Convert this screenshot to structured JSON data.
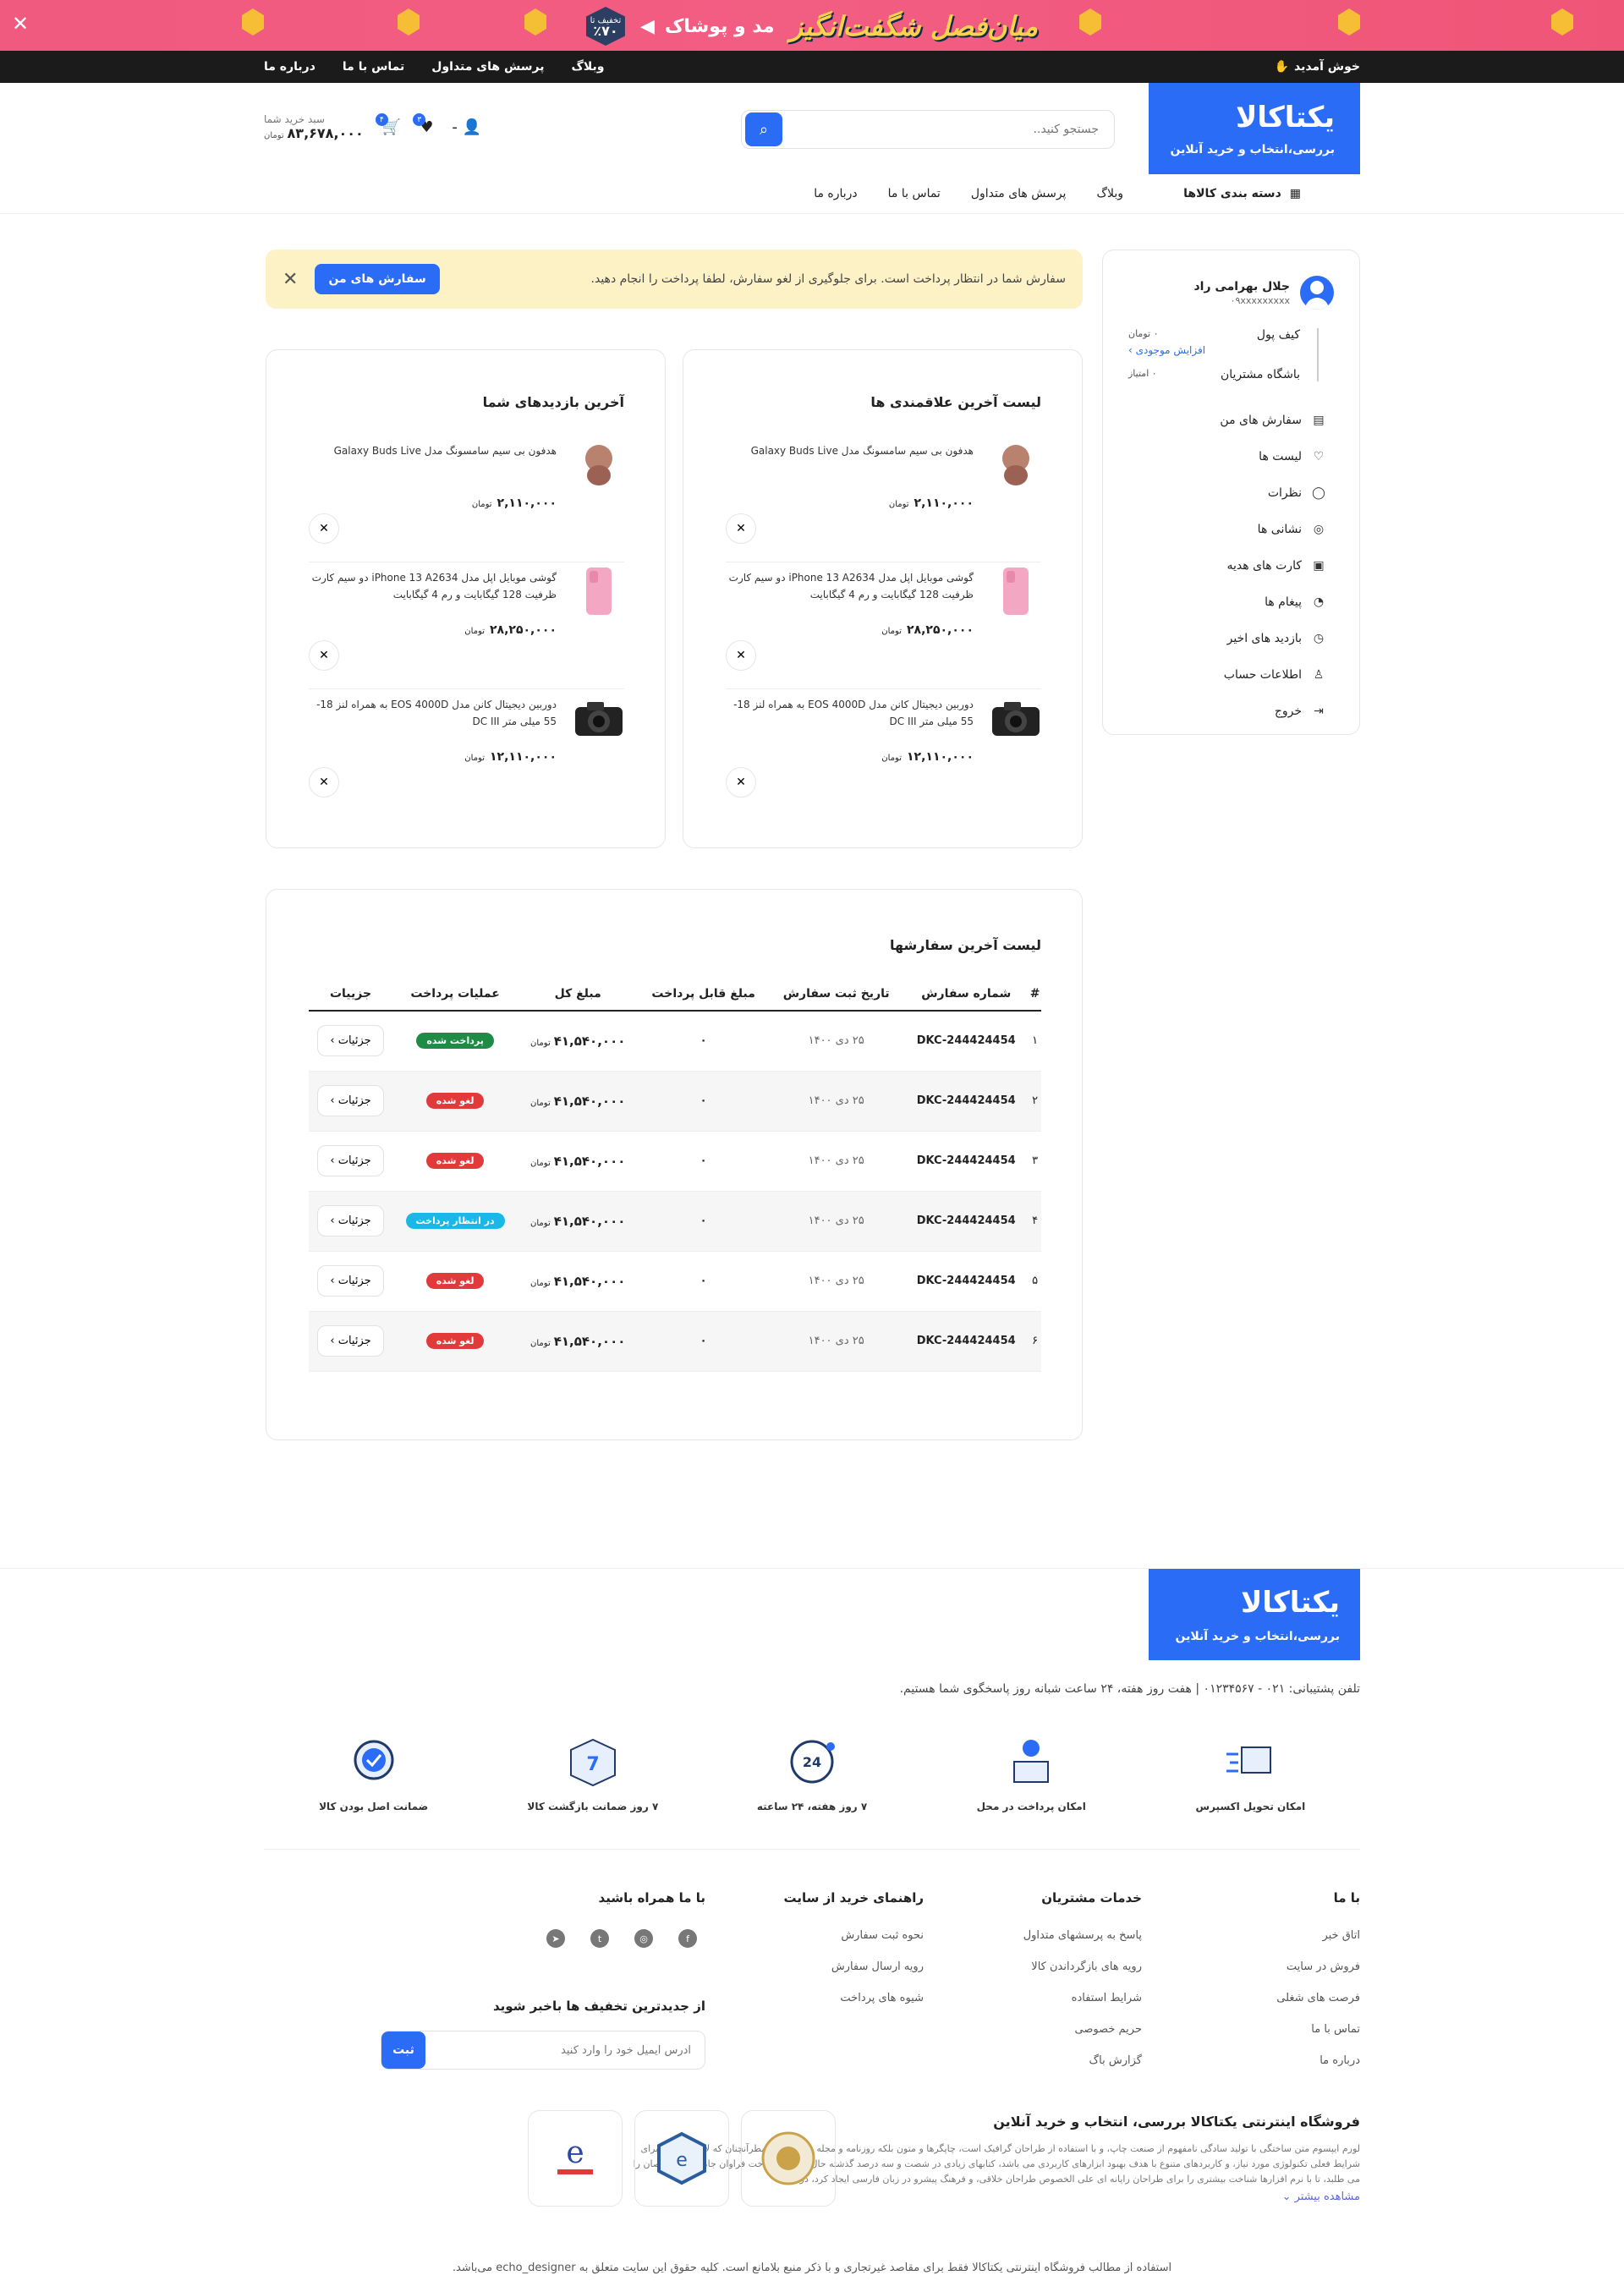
{
  "promo": {
    "title": "میان‌فصل شگفت‌انگیز",
    "subtitle": "مد و پوشاک",
    "badge_label": "تخفیف تا",
    "badge_value": "٪۷۰"
  },
  "topbar": {
    "welcome": "خوش آمدید",
    "links": [
      "وبلاگ",
      "پرسش های متداول",
      "تماس با ما",
      "درباره ما"
    ]
  },
  "header": {
    "logo_title": "یکتاکالا",
    "logo_subtitle": "بررسی،انتخاب و خرید آنلاین",
    "search_placeholder": "جستجو کنید..",
    "user_label": "-",
    "wishlist_count": "۳",
    "cart_count": "۴",
    "cart_label": "سبد خرید شما",
    "cart_total": "۸۳,۶۷۸,۰۰۰",
    "cart_currency": "تومان"
  },
  "nav": {
    "categories": "دسته بندی کالاها",
    "links": [
      "وبلاگ",
      "پرسش های متداول",
      "تماس با ما",
      "درباره ما"
    ]
  },
  "sidebar": {
    "name": "جلال بهرامی راد",
    "phone": "۰۹xxxxxxxxx",
    "wallet_label": "کیف پول",
    "wallet_value": "۰ تومان",
    "wallet_link": "افزایش موجودی ›",
    "club_label": "باشگاه مشتریان",
    "club_value": "۰ امتیاز",
    "menu": [
      {
        "label": "سفارش های من",
        "icon": "orders-icon",
        "glyph": "▤"
      },
      {
        "label": "لیست ها",
        "icon": "heart-icon",
        "glyph": "♡"
      },
      {
        "label": "نظرات",
        "icon": "comment-icon",
        "glyph": "◯"
      },
      {
        "label": "نشانی ها",
        "icon": "location-icon",
        "glyph": "◎"
      },
      {
        "label": "کارت های هدیه",
        "icon": "gift-icon",
        "glyph": "▣"
      },
      {
        "label": "پیغام ها",
        "icon": "bell-icon",
        "glyph": "◔"
      },
      {
        "label": "بازدید های اخیر",
        "icon": "clock-icon",
        "glyph": "◷"
      },
      {
        "label": "اطلاعات حساب",
        "icon": "user-icon",
        "glyph": "♙"
      },
      {
        "label": "خروج",
        "icon": "logout-icon",
        "glyph": "⇥"
      }
    ]
  },
  "alert": {
    "message": "سفارش شما در انتظار پرداخت است. برای جلوگیری از لغو سفارش، لطفا پرداخت را انجام دهید.",
    "button": "سفارش های من"
  },
  "wishlist": {
    "title": "لیست آخرین علاقمندی ها",
    "items": [
      {
        "title": "هدفون بی سیم سامسونگ مدل Galaxy Buds Live",
        "price": "۲,۱۱۰,۰۰۰",
        "currency": "تومان",
        "kind": "buds"
      },
      {
        "title": "گوشی موبایل اپل مدل iPhone 13 A2634 دو سیم کارت ظرفیت 128 گیگابایت و رم 4 گیگابایت",
        "price": "۲۸,۲۵۰,۰۰۰",
        "currency": "تومان",
        "kind": "phone"
      },
      {
        "title": "دوربین دیجیتال کانن مدل EOS 4000D به همراه لنز 18-55 میلی متر DC III",
        "price": "۱۲,۱۱۰,۰۰۰",
        "currency": "تومان",
        "kind": "camera"
      }
    ]
  },
  "recent": {
    "title": "آخرین بازدیدهای شما",
    "items": [
      {
        "title": "هدفون بی سیم سامسونگ مدل Galaxy Buds Live",
        "price": "۲,۱۱۰,۰۰۰",
        "currency": "تومان",
        "kind": "buds"
      },
      {
        "title": "گوشی موبایل اپل مدل iPhone 13 A2634 دو سیم کارت ظرفیت 128 گیگابایت و رم 4 گیگابایت",
        "price": "۲۸,۲۵۰,۰۰۰",
        "currency": "تومان",
        "kind": "phone"
      },
      {
        "title": "دوربین دیجیتال کانن مدل EOS 4000D به همراه لنز 18-55 میلی متر DC III",
        "price": "۱۲,۱۱۰,۰۰۰",
        "currency": "تومان",
        "kind": "camera"
      }
    ]
  },
  "orders": {
    "title": "لیست آخرین سفارشها",
    "headers": [
      "#",
      "شماره سفارش",
      "تاریخ ثبت سفارش",
      "مبلغ قابل پرداخت",
      "مبلغ کل",
      "عملیات پرداخت",
      "جزییات"
    ],
    "rows": [
      {
        "idx": "۱",
        "id": "DKC-244424454",
        "date": "۲۵ دی ۱۴۰۰",
        "payable": "۰",
        "total": "۴۱,۵۴۰,۰۰۰",
        "currency": "تومان",
        "status": "پرداخت شده",
        "status_type": "paid",
        "details": "جزئیات ›"
      },
      {
        "idx": "۲",
        "id": "DKC-244424454",
        "date": "۲۵ دی ۱۴۰۰",
        "payable": "۰",
        "total": "۴۱,۵۴۰,۰۰۰",
        "currency": "تومان",
        "status": "لغو شده",
        "status_type": "cancel",
        "details": "جزئیات ›"
      },
      {
        "idx": "۳",
        "id": "DKC-244424454",
        "date": "۲۵ دی ۱۴۰۰",
        "payable": "۰",
        "total": "۴۱,۵۴۰,۰۰۰",
        "currency": "تومان",
        "status": "لغو شده",
        "status_type": "cancel",
        "details": "جزئیات ›"
      },
      {
        "idx": "۴",
        "id": "DKC-244424454",
        "date": "۲۵ دی ۱۴۰۰",
        "payable": "۰",
        "total": "۴۱,۵۴۰,۰۰۰",
        "currency": "تومان",
        "status": "در انتظار پرداخت",
        "status_type": "wait",
        "details": "جزئیات ›"
      },
      {
        "idx": "۵",
        "id": "DKC-244424454",
        "date": "۲۵ دی ۱۴۰۰",
        "payable": "۰",
        "total": "۴۱,۵۴۰,۰۰۰",
        "currency": "تومان",
        "status": "لغو شده",
        "status_type": "cancel",
        "details": "جزئیات ›"
      },
      {
        "idx": "۶",
        "id": "DKC-244424454",
        "date": "۲۵ دی ۱۴۰۰",
        "payable": "۰",
        "total": "۴۱,۵۴۰,۰۰۰",
        "currency": "تومان",
        "status": "لغو شده",
        "status_type": "cancel",
        "details": "جزئیات ›"
      }
    ]
  },
  "footer": {
    "logo_title": "یکتاکالا",
    "logo_subtitle": "بررسی،انتخاب و خرید آنلاین",
    "support": "تلفن پشتیبانی: ۰۲۱ - ۰۱۲۳۴۵۶۷ | هفت روز هفته، ۲۴ ساعت شبانه روز پاسخگوی شما هستیم.",
    "features": [
      {
        "label": "امکان تحویل اکسپرس",
        "icon": "express-delivery-icon"
      },
      {
        "label": "امکان پرداخت در محل",
        "icon": "cash-on-delivery-icon"
      },
      {
        "label": "۷ روز هفته، ۲۴ ساعته",
        "icon": "support-24-7-icon"
      },
      {
        "label": "۷ روز ضمانت بازگشت کالا",
        "icon": "return-guarantee-icon"
      },
      {
        "label": "ضمانت اصل بودن کالا",
        "icon": "original-badge-icon"
      }
    ],
    "col1": {
      "title": "با ما",
      "links": [
        "اتاق خبر",
        "فروش در سایت",
        "فرصت های شغلی",
        "تماس با ما",
        "درباره ما"
      ]
    },
    "col2": {
      "title": "خدمات مشتریان",
      "links": [
        "پاسخ به پرسشهای متداول",
        "رویه های بازگرداندن کالا",
        "شرایط استفاده",
        "حریم خصوصی",
        "گزارش باگ"
      ]
    },
    "col3": {
      "title": "راهنمای خرید از سایت",
      "links": [
        "نحوه ثبت سفارش",
        "رویه ارسال سفارش",
        "شیوه های پرداخت"
      ]
    },
    "col4": {
      "title": "با ما همراه باشید"
    },
    "newsletter_title": "از جدیدترین تخفیف ها باخبر شوید",
    "newsletter_placeholder": "آدرس ایمیل خود را وارد کنید",
    "newsletter_button": "ثبت",
    "about_title": "فروشگاه اینترنتی یکتاکالا بررسی، انتخاب و خرید آنلاین",
    "about_text": "لورم ایپسوم متن ساختگی با تولید سادگی نامفهوم از صنعت چاپ، و با استفاده از طراحان گرافیک است، چاپگرها و متون بلکه روزنامه و مجله در ستون و سطرآنچنان که لازم است، و برای شرایط فعلی تکنولوژی مورد نیاز، و کاربردهای متنوع با هدف بهبود ابزارهای کاربردی می باشد، کتابهای زیادی در شصت و سه درصد گذشته حال و آینده، شناخت فراوان جامعه و متخصصان را می طلبد، تا با نرم افزارها شناخت بیشتری را برای طراحان رایانه ای علی الخصوص طراحان خلاقی، و فرهنگ پیشرو در زبان فارسی ایجاد کرد، در",
    "about_more": "مشاهده بیشتر ⌄",
    "copyright": "استفاده از مطالب فروشگاه اینترنتی یکتاکالا فقط برای مقاصد غیرتجاری و با ذکر منبع بلامانع است. کلیه حقوق این سایت متعلق به echo_designer می‌باشد."
  },
  "colors": {
    "primary": "#2b6cf6",
    "promo": "#f05a7e",
    "paid": "#1e8c45",
    "cancel": "#e23a3a",
    "wait": "#19b8e6",
    "alert_bg": "#fdf1c6"
  }
}
